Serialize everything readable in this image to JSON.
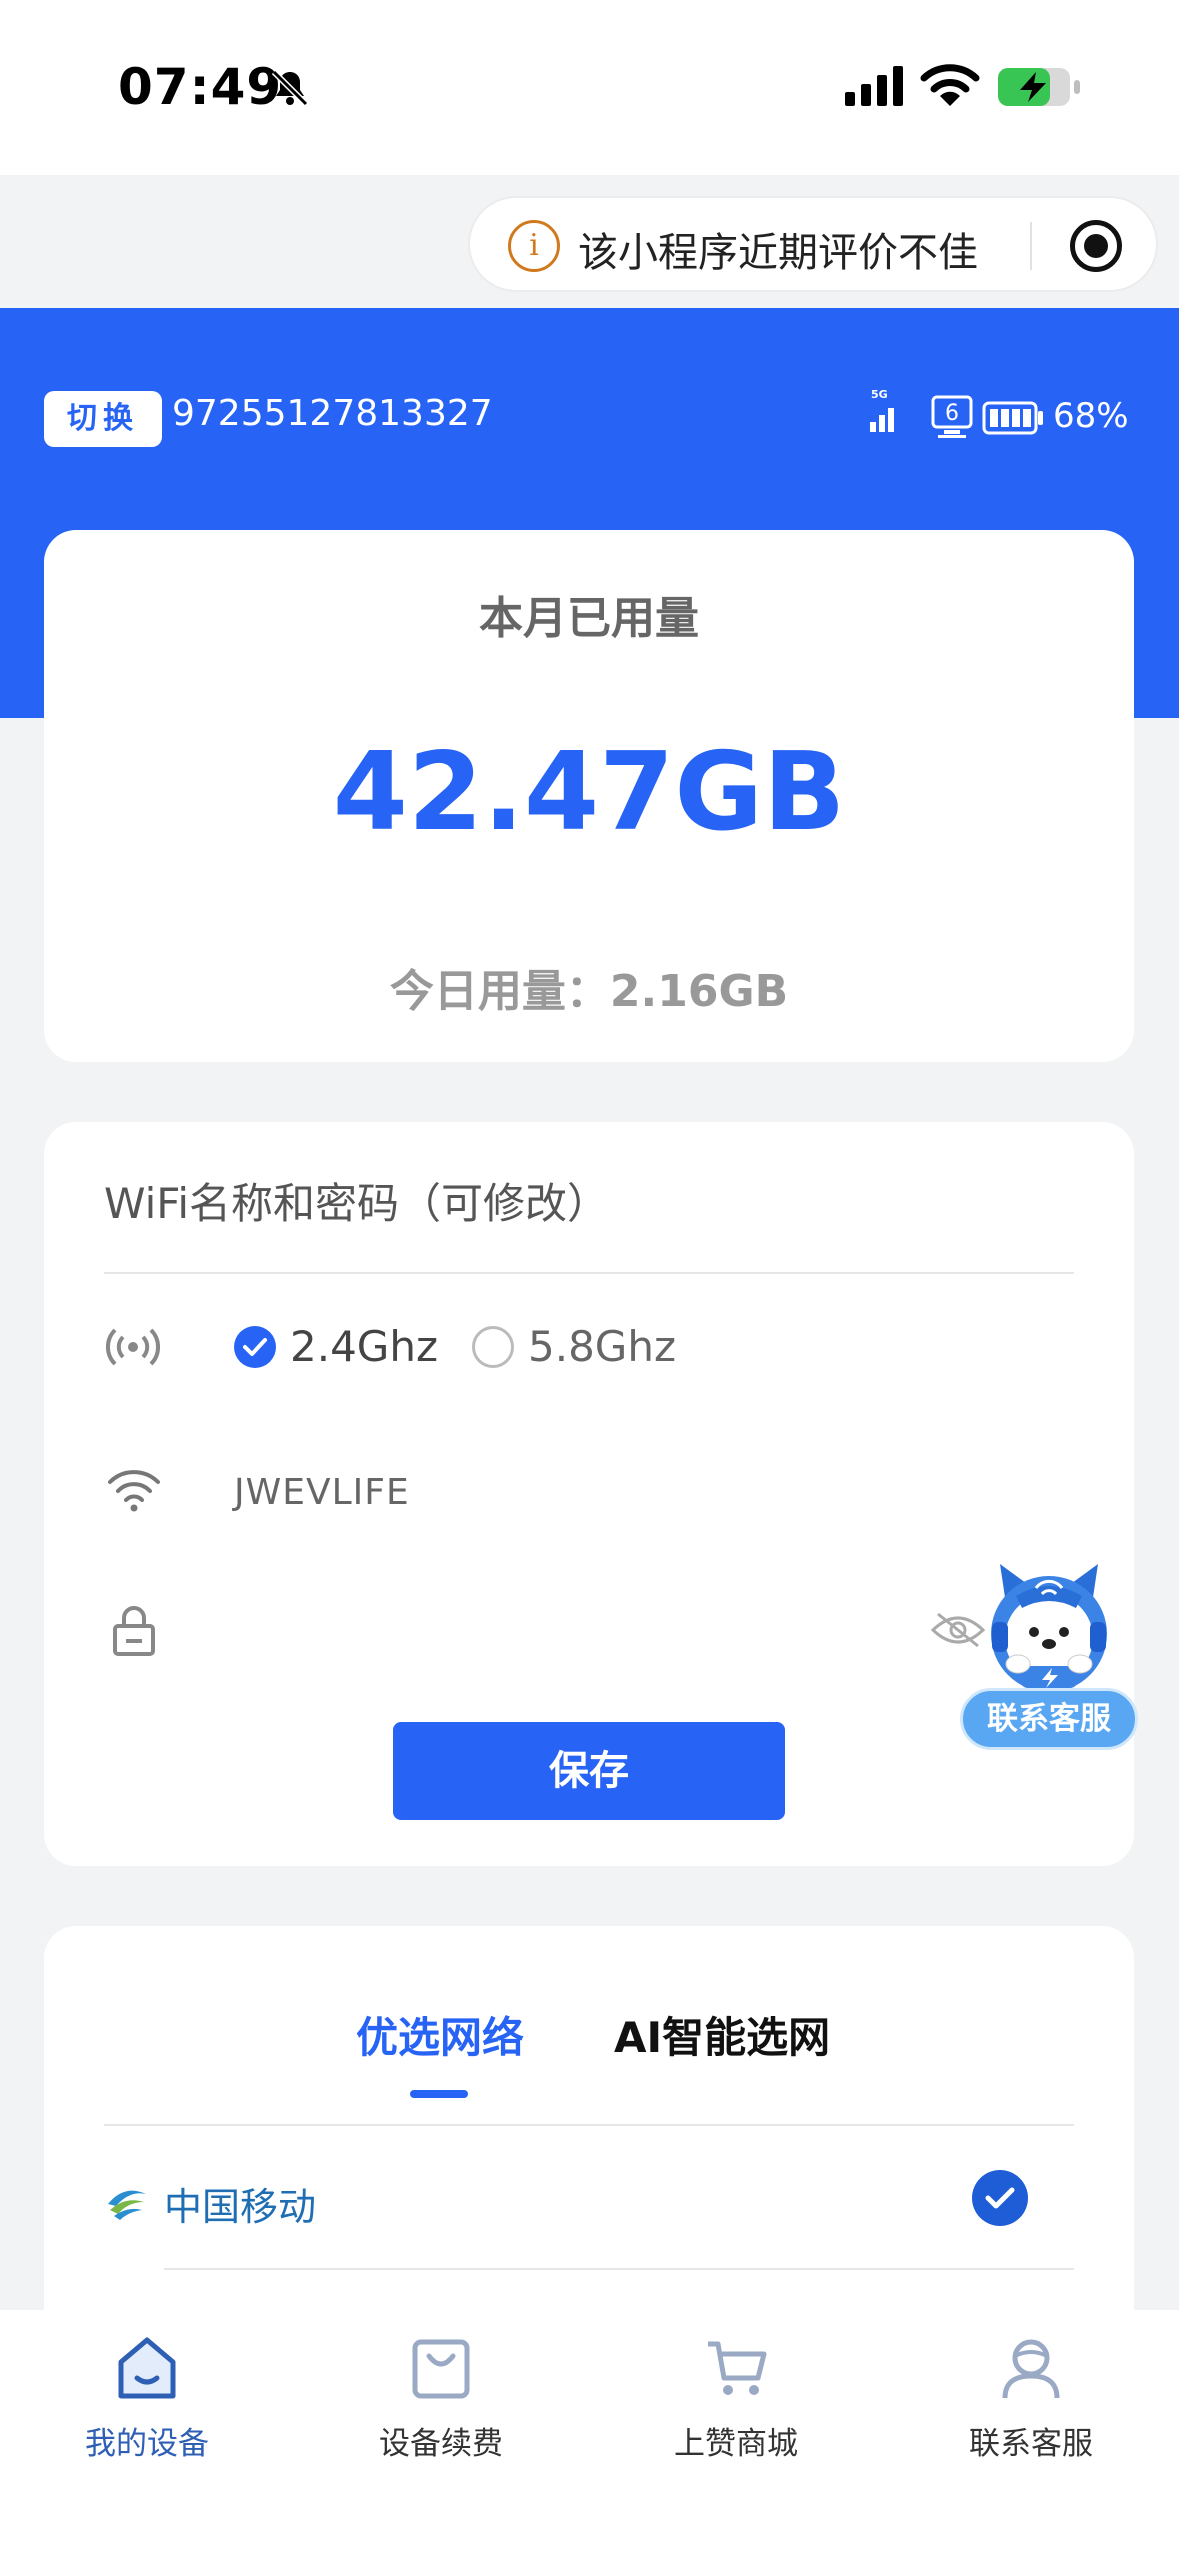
{
  "status_bar": {
    "time": "07:49"
  },
  "capsule": {
    "warning_text": "该小程序近期评价不佳",
    "warn_glyph": "i"
  },
  "header": {
    "switch_label": "切换",
    "device_id": "97255127813327",
    "network_badge": "5G",
    "connected_users": "6",
    "battery_percent": "68%",
    "accent_color": "#2764f5"
  },
  "usage": {
    "title": "本月已用量",
    "month_value": "42.47GB",
    "today_text": "今日用量：2.16GB"
  },
  "wifi": {
    "title": "WiFi名称和密码（可修改）",
    "band_options": [
      {
        "label": "2.4Ghz",
        "selected": true
      },
      {
        "label": "5.8Ghz",
        "selected": false
      }
    ],
    "ssid": "JWEVLIFE",
    "password": "",
    "save_label": "保存"
  },
  "customer_service_float": {
    "label": "联系客服"
  },
  "network": {
    "tabs": [
      {
        "label": "优选网络",
        "active": true
      },
      {
        "label": "AI智能选网",
        "active": false
      }
    ],
    "carriers": [
      {
        "name": "中国移动",
        "selected": true
      }
    ]
  },
  "tab_bar": {
    "items": [
      {
        "label": "我的设备",
        "icon": "home-icon",
        "active": true
      },
      {
        "label": "设备续费",
        "icon": "bag-icon",
        "active": false
      },
      {
        "label": "上赞商城",
        "icon": "cart-icon",
        "active": false
      },
      {
        "label": "联系客服",
        "icon": "person-icon",
        "active": false
      }
    ]
  }
}
